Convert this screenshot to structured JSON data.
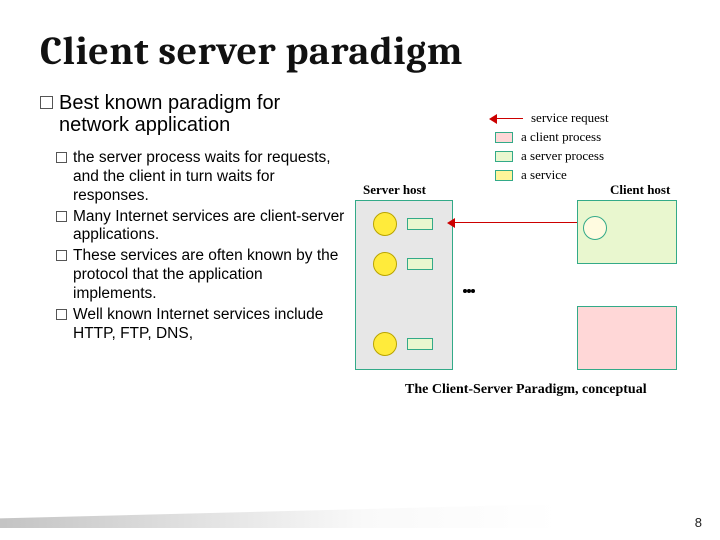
{
  "slide": {
    "title": "Client server paradigm",
    "lead": "Best known paradigm for network application",
    "bullets": [
      "the server process waits for requests, and the client in turn waits for responses.",
      " Many Internet services are client-server applications.",
      "These services are often known by the protocol that the application implements.",
      "Well known Internet services include HTTP, FTP, DNS,"
    ],
    "page_number": "8"
  },
  "diagram": {
    "legend": {
      "service_request": "service request",
      "client_process": "a client process",
      "server_process": "a server process",
      "a_service": "a service"
    },
    "server_host_label": "Server host",
    "client_host_label": "Client host",
    "ellipsis": "...",
    "caption": "The Client-Server Paradigm, conceptual"
  }
}
